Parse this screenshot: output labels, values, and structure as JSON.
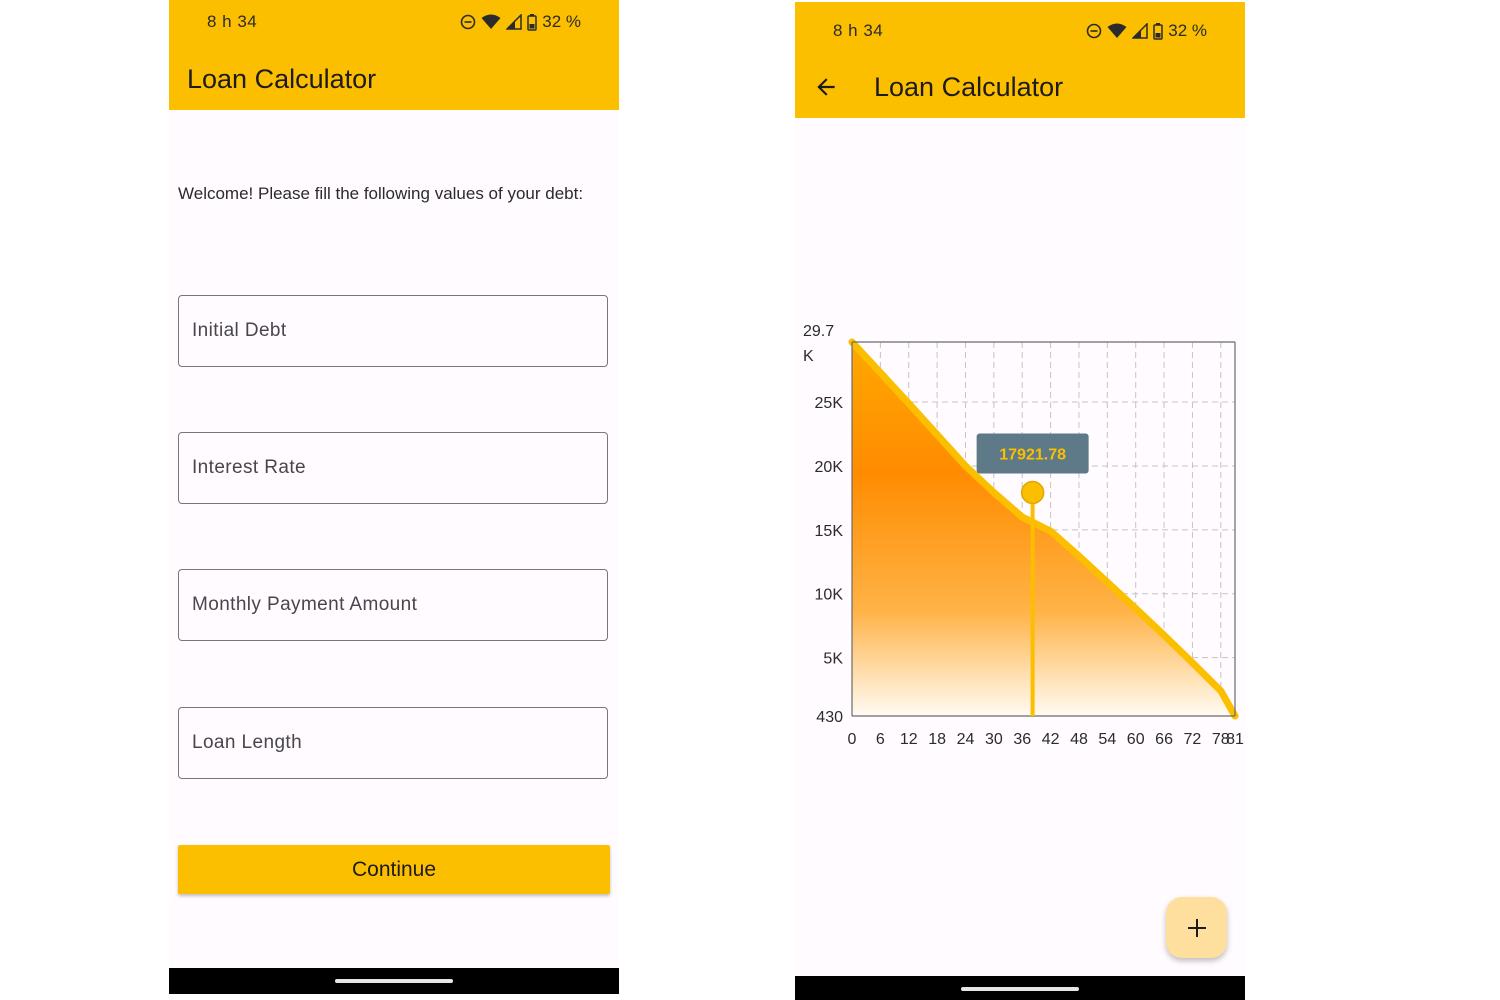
{
  "status_bar": {
    "time": "8 h 34",
    "battery": "32 %",
    "icons": [
      "dnd-icon",
      "wifi-icon",
      "signal-icon",
      "battery-icon"
    ]
  },
  "app": {
    "title": "Loan Calculator"
  },
  "form_screen": {
    "welcome": "Welcome! Please fill the following values of your debt:",
    "fields": [
      {
        "placeholder": "Initial Debt",
        "value": ""
      },
      {
        "placeholder": "Interest Rate",
        "value": ""
      },
      {
        "placeholder": "Monthly Payment Amount",
        "value": ""
      },
      {
        "placeholder": "Loan Length",
        "value": ""
      }
    ],
    "continue_label": "Continue"
  },
  "chart_screen": {
    "back_icon": "arrow-back-icon",
    "fab_icon": "plus-icon",
    "tooltip": "17921.78"
  },
  "colors": {
    "primary": "#fbbf00",
    "area_top": "#ff8c00",
    "tooltip_bg": "#5e7a88",
    "fab": "#ffdf9e",
    "background": "#fffbfe"
  },
  "chart_data": {
    "type": "area",
    "title": "",
    "xlabel": "",
    "ylabel": "",
    "xlim": [
      0,
      81
    ],
    "ylim": [
      430,
      29700
    ],
    "x_ticks": [
      "0",
      "6",
      "12",
      "18",
      "24",
      "30",
      "36",
      "42",
      "48",
      "54",
      "60",
      "66",
      "72",
      "78",
      "81"
    ],
    "y_ticks": [
      {
        "value": 430,
        "label": "430"
      },
      {
        "value": 5000,
        "label": "5K"
      },
      {
        "value": 10000,
        "label": "10K"
      },
      {
        "value": 15000,
        "label": "15K"
      },
      {
        "value": 20000,
        "label": "20K"
      },
      {
        "value": 25000,
        "label": "25K"
      },
      {
        "value": 29700,
        "label": "29.7\nK"
      }
    ],
    "grid": "dashed",
    "series": [
      {
        "x": [
          0,
          6,
          12,
          18,
          24,
          30,
          36,
          42,
          48,
          54,
          60,
          66,
          72,
          78,
          81
        ],
        "y": [
          29700,
          27300,
          24900,
          22450,
          20000,
          17921.78,
          16000,
          14900,
          12950,
          10900,
          8850,
          6750,
          4600,
          2400,
          430
        ]
      }
    ],
    "highlight": {
      "x": 38.2,
      "y": 17921.78,
      "label": "17921.78"
    }
  }
}
